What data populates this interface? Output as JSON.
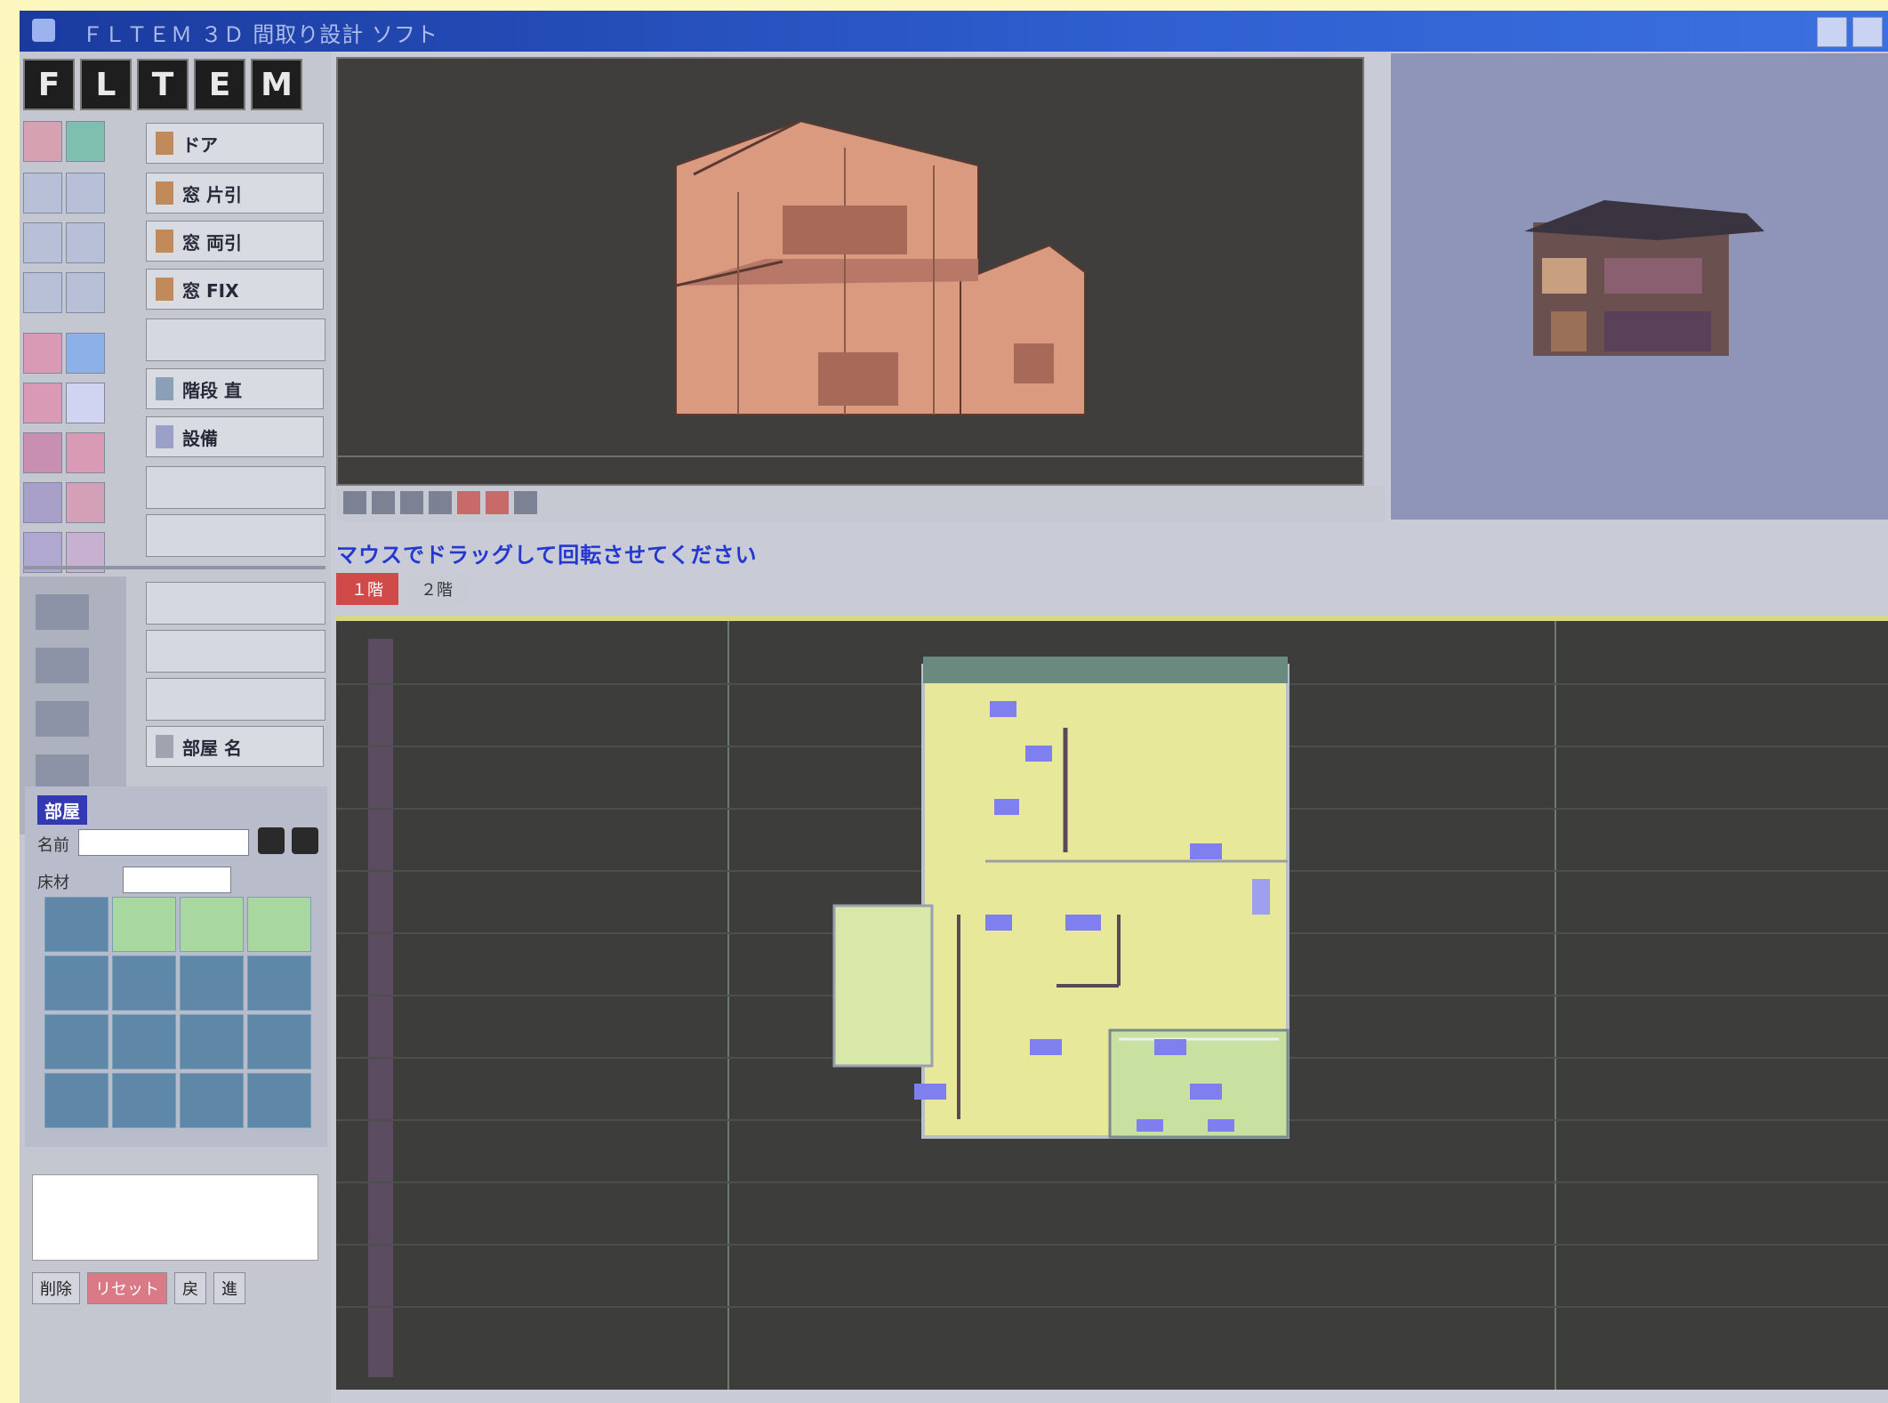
{
  "window": {
    "title": "ＦＬＴＥＭ ３Ｄ 間取り設計 ソフト"
  },
  "toolbar": {
    "letters": [
      "F",
      "L",
      "T",
      "E",
      "M"
    ]
  },
  "tool_buttons": [
    {
      "label": "ドア"
    },
    {
      "label": "窓 片引"
    },
    {
      "label": "窓 両引"
    },
    {
      "label": "窓 FIX"
    },
    {
      "label": "階段 直"
    },
    {
      "label": "設備"
    },
    {
      "label": "部屋 名"
    }
  ],
  "properties_panel": {
    "title": "部屋",
    "name_label": "名前",
    "name_value": "",
    "floor_label": "床材",
    "floor_value": ""
  },
  "bottom_buttons": [
    "削除",
    "リセット",
    "戻",
    "進"
  ],
  "elevation_hint": "マウスでドラッグして回転させてください",
  "plan_tabs": [
    "１階",
    "２階"
  ],
  "colors": {
    "titlebar": "#1a3a9e",
    "viewport_bg": "#3f3e3c",
    "wall": "#d99a80",
    "floor": "#e8e89a",
    "thumb_bg": "#8f94b9",
    "hint": "#2437d0",
    "active_tab": "#d04a4a"
  }
}
